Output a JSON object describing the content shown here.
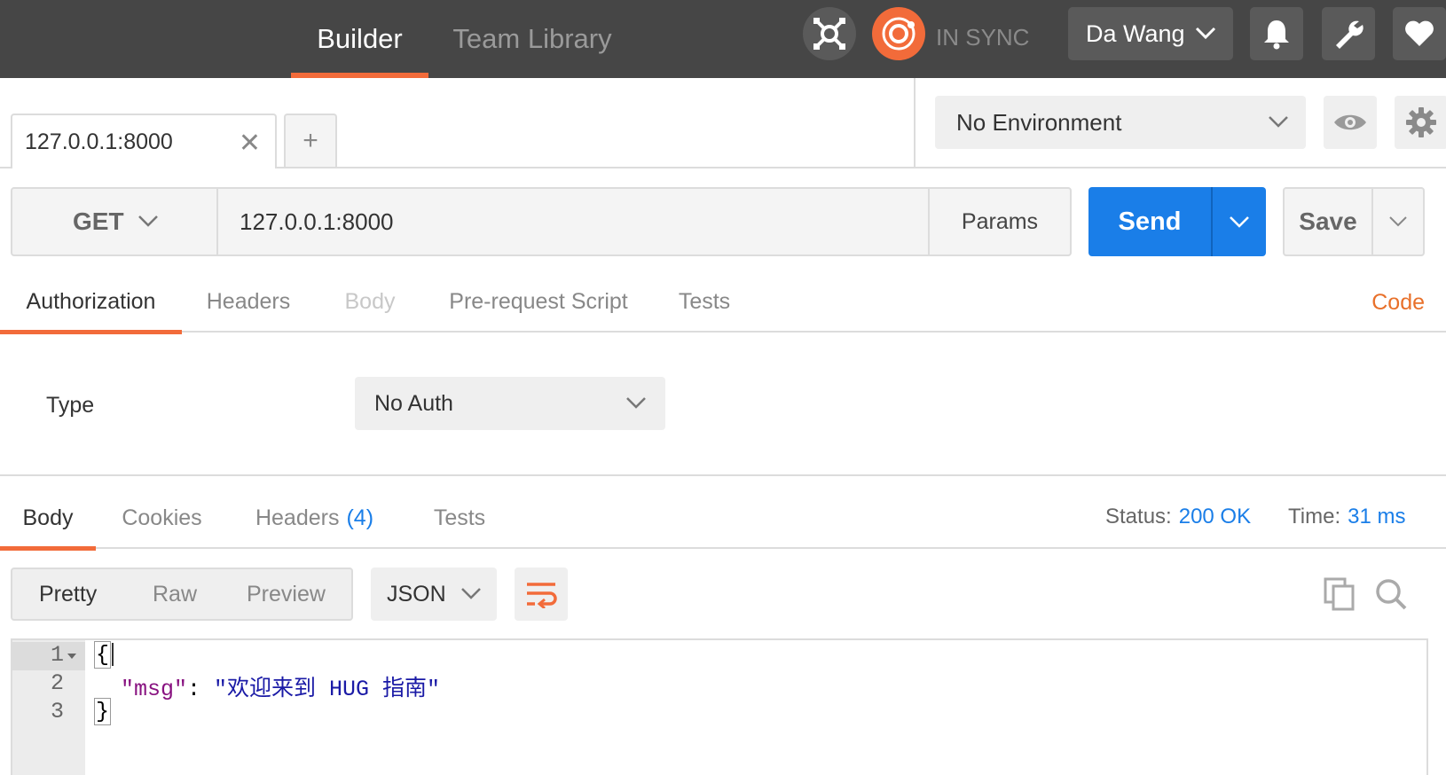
{
  "header": {
    "tabs": [
      {
        "label": "Builder",
        "active": true
      },
      {
        "label": "Team Library",
        "active": false
      }
    ],
    "sync_status": "IN SYNC",
    "user_name": "Da Wang",
    "icons": [
      "interceptor-icon",
      "sync-icon",
      "bell-icon",
      "wrench-icon",
      "heart-icon"
    ]
  },
  "request_tabs": {
    "tabs": [
      {
        "label": "127.0.0.1:8000"
      }
    ],
    "new_tab_label": "+"
  },
  "environment": {
    "selected": "No Environment"
  },
  "request": {
    "method": "GET",
    "url": "127.0.0.1:8000",
    "params_label": "Params",
    "send_label": "Send",
    "save_label": "Save"
  },
  "request_section": {
    "tabs": [
      {
        "label": "Authorization",
        "state": "active"
      },
      {
        "label": "Headers",
        "state": "normal"
      },
      {
        "label": "Body",
        "state": "disabled"
      },
      {
        "label": "Pre-request Script",
        "state": "normal"
      },
      {
        "label": "Tests",
        "state": "normal"
      }
    ],
    "code_link": "Code"
  },
  "auth": {
    "type_label": "Type",
    "selected": "No Auth"
  },
  "response": {
    "tabs": [
      {
        "label": "Body",
        "state": "active"
      },
      {
        "label": "Cookies",
        "state": "normal"
      },
      {
        "label": "Headers",
        "count": "(4)",
        "state": "normal"
      },
      {
        "label": "Tests",
        "state": "normal"
      }
    ],
    "status_label": "Status:",
    "status_value": "200 OK",
    "time_label": "Time:",
    "time_value": "31 ms",
    "view_modes": [
      {
        "label": "Pretty",
        "active": true
      },
      {
        "label": "Raw",
        "active": false
      },
      {
        "label": "Preview",
        "active": false
      }
    ],
    "format": "JSON",
    "lines": [
      {
        "number": "1",
        "text": "{"
      },
      {
        "number": "2",
        "key": "\"msg\"",
        "sep": ": ",
        "value": "\"欢迎来到 HUG 指南\""
      },
      {
        "number": "3",
        "text": "}"
      }
    ]
  },
  "colors": {
    "accent": "#f26b3a",
    "primary": "#1a7ee8",
    "topbar": "#464646"
  }
}
